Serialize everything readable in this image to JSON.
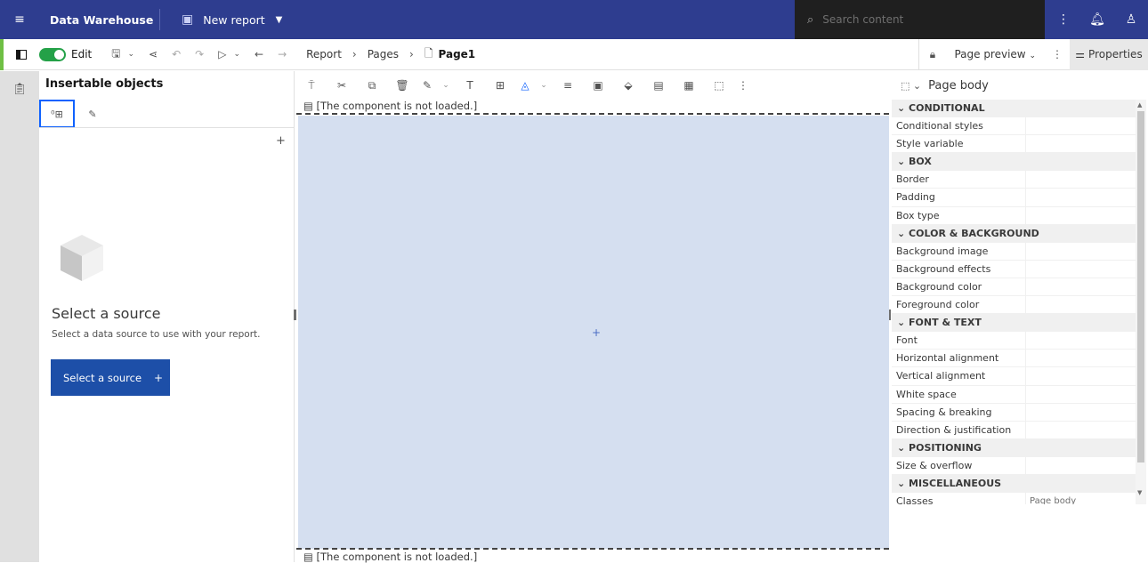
{
  "topbar": {
    "app_name": "Data Warehouse",
    "report_title": "New report",
    "search_placeholder": "Search content"
  },
  "toolbar": {
    "edit_label": "Edit",
    "breadcrumb": [
      "Report",
      "Pages",
      "Page1"
    ],
    "preview_label": "Page preview",
    "properties_label": "Properties"
  },
  "insertable": {
    "title": "Insertable objects",
    "select_title": "Select a source",
    "select_desc": "Select a data source to use with your report.",
    "select_button": "Select a source"
  },
  "canvas": {
    "not_loaded_top": "[The component is not loaded.]",
    "not_loaded_bottom": "[The component is not loaded.]"
  },
  "properties": {
    "header": "Page body",
    "sections": [
      {
        "title": "CONDITIONAL",
        "rows": [
          "Conditional styles",
          "Style variable"
        ]
      },
      {
        "title": "BOX",
        "rows": [
          "Border",
          "Padding",
          "Box type"
        ]
      },
      {
        "title": "COLOR & BACKGROUND",
        "rows": [
          "Background image",
          "Background effects",
          "Background color",
          "Foreground color"
        ]
      },
      {
        "title": "FONT & TEXT",
        "rows": [
          "Font",
          "Horizontal alignment",
          "Vertical alignment",
          "White space",
          "Spacing & breaking",
          "Direction & justification"
        ]
      },
      {
        "title": "POSITIONING",
        "rows": [
          "Size & overflow"
        ]
      },
      {
        "title": "MISCELLANEOUS",
        "rows": [
          "Classes"
        ]
      }
    ],
    "classes_value": "Page body"
  },
  "colors": {
    "brand_bar": "#2e3d8f",
    "edit_toggle": "#24a148",
    "primary_button": "#1d4fa8",
    "canvas_body": "#d5dff0"
  }
}
